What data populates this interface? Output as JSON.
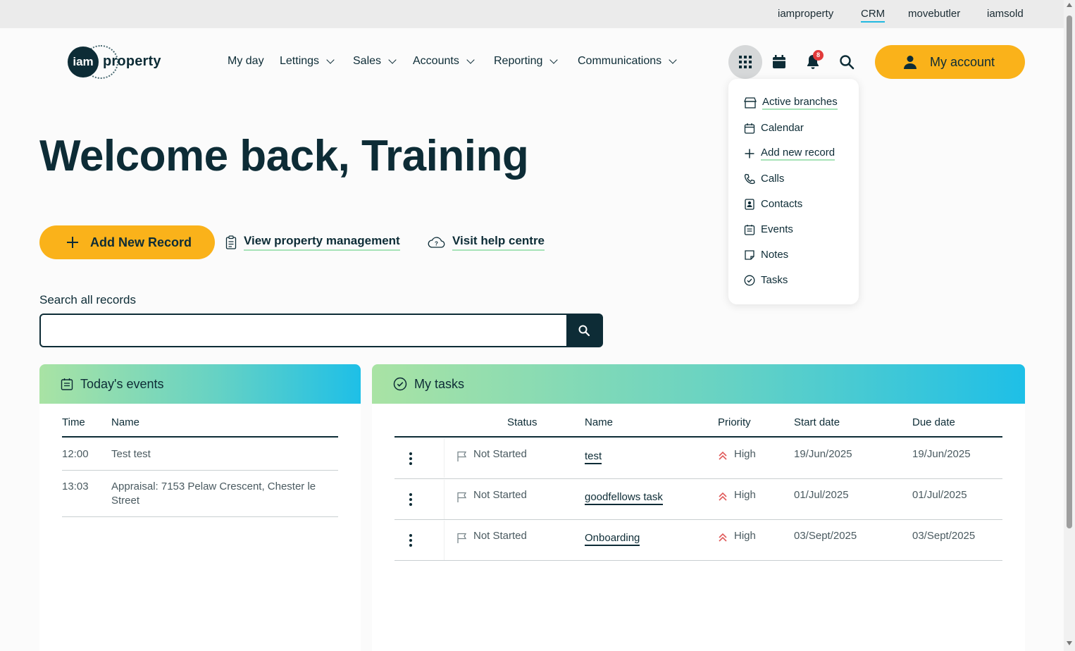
{
  "topbar": {
    "links": [
      "iamproperty",
      "CRM",
      "movebutler",
      "iamsold"
    ],
    "active": "CRM"
  },
  "brand": {
    "mark": "iam",
    "word": "property"
  },
  "nav": [
    "My day",
    "Lettings",
    "Sales",
    "Accounts",
    "Reporting",
    "Communications"
  ],
  "header": {
    "notification_count": "8",
    "account_label": "My account"
  },
  "apps_menu": [
    "Active branches",
    "Calendar",
    "Add new record",
    "Calls",
    "Contacts",
    "Events",
    "Notes",
    "Tasks"
  ],
  "welcome": "Welcome back, Training",
  "actions": {
    "add_record": "Add New Record",
    "view_pm": "View property management",
    "help": "Visit help centre"
  },
  "search": {
    "label": "Search all records",
    "value": ""
  },
  "events": {
    "title": "Today's events",
    "columns": [
      "Time",
      "Name"
    ],
    "rows": [
      {
        "time": "12:00",
        "name": "Test test"
      },
      {
        "time": "13:03",
        "name": "Appraisal: 7153 Pelaw Crescent, Chester le Street"
      }
    ]
  },
  "tasks": {
    "title": "My tasks",
    "columns": [
      "Status",
      "Name",
      "Priority",
      "Start date",
      "Due date"
    ],
    "rows": [
      {
        "status": "Not Started",
        "name": "test",
        "priority": "High",
        "start": "19/Jun/2025",
        "due": "19/Jun/2025"
      },
      {
        "status": "Not Started",
        "name": "goodfellows task",
        "priority": "High",
        "start": "01/Jul/2025",
        "due": "01/Jul/2025"
      },
      {
        "status": "Not Started",
        "name": "Onboarding",
        "priority": "High",
        "start": "03/Sept/2025",
        "due": "03/Sept/2025"
      }
    ]
  },
  "colors": {
    "accent": "#fab21a",
    "navy": "#0d2c36",
    "link_underline": "#a7e3b8",
    "priority_high": "#e05a5a"
  }
}
